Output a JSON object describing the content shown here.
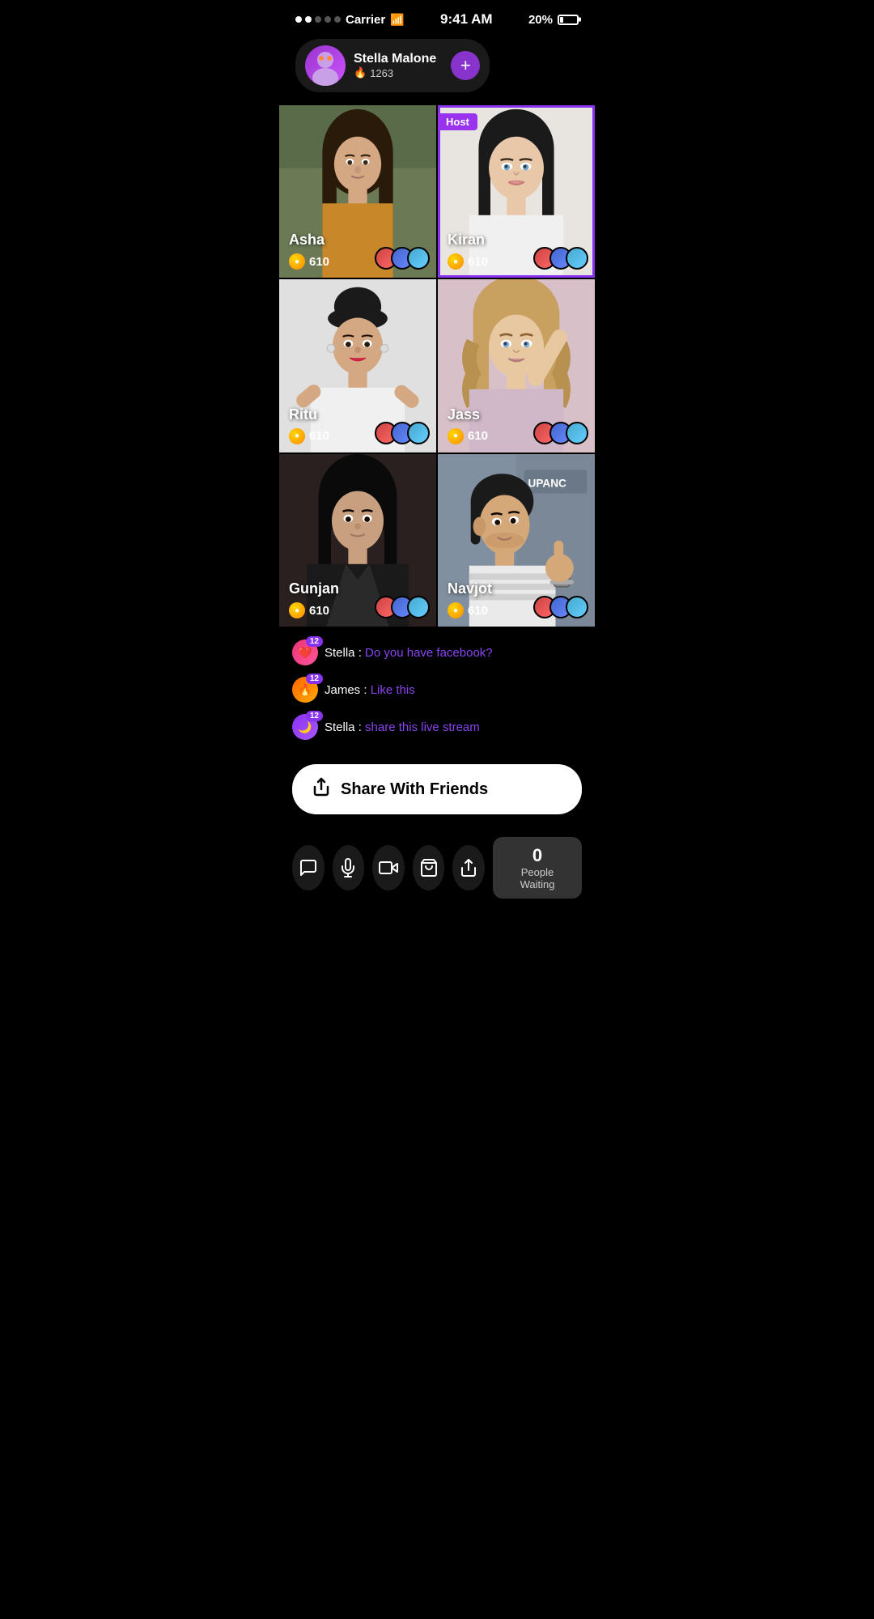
{
  "statusBar": {
    "carrier": "Carrier",
    "time": "9:41 AM",
    "battery": "20%",
    "signalFull": 2,
    "signalEmpty": 3
  },
  "profile": {
    "name": "Stella Malone",
    "score": "1263",
    "addLabel": "+",
    "emoji": "👤"
  },
  "grid": [
    {
      "id": "asha",
      "name": "Asha",
      "coins": "610",
      "isHost": false,
      "bgClass": "bg-asha"
    },
    {
      "id": "kiran",
      "name": "Kiran",
      "coins": "610",
      "isHost": true,
      "hostLabel": "Host",
      "bgClass": "bg-kiran"
    },
    {
      "id": "ritu",
      "name": "Ritu",
      "coins": "610",
      "isHost": false,
      "bgClass": "bg-ritu"
    },
    {
      "id": "jass",
      "name": "Jass",
      "coins": "610",
      "isHost": false,
      "bgClass": "bg-jass"
    },
    {
      "id": "gunjan",
      "name": "Gunjan",
      "coins": "610",
      "isHost": false,
      "bgClass": "bg-gunjan"
    },
    {
      "id": "navjot",
      "name": "Navjot",
      "coins": "610",
      "isHost": false,
      "bgClass": "bg-navjot"
    }
  ],
  "chat": [
    {
      "user": "Stella",
      "message": "Do you have facebook?",
      "badgeType": "heart",
      "badgeCount": "12",
      "badgeEmoji": "❤️"
    },
    {
      "user": "James",
      "message": "Like this",
      "badgeType": "fire",
      "badgeCount": "12",
      "badgeEmoji": "🔥"
    },
    {
      "user": "Stella",
      "message": "share this live stream",
      "badgeType": "purple",
      "badgeCount": "12",
      "badgeEmoji": "🌙"
    }
  ],
  "shareButton": {
    "label": "Share With Friends",
    "icon": "↗"
  },
  "bottomBar": {
    "actions": [
      {
        "icon": "💬",
        "name": "chat-button"
      },
      {
        "icon": "🎤",
        "name": "mic-button"
      },
      {
        "icon": "📹",
        "name": "camera-button"
      },
      {
        "icon": "👜",
        "name": "bag-button"
      },
      {
        "icon": "↗",
        "name": "share-action-button"
      }
    ]
  },
  "peopleWaiting": {
    "count": "0",
    "label": "People Waiting"
  }
}
